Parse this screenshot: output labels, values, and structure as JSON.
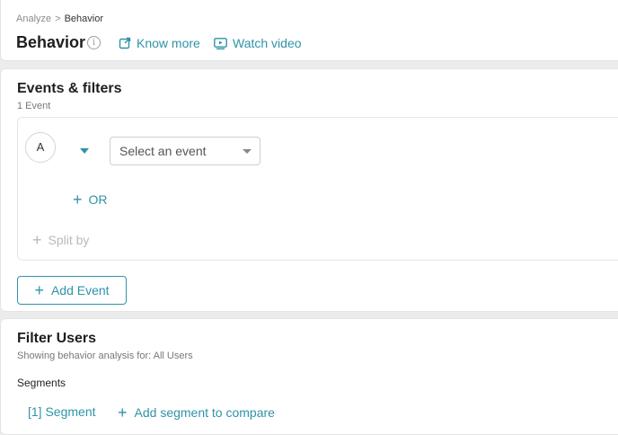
{
  "breadcrumb": {
    "parent": "Analyze",
    "separator": ">",
    "current": "Behavior"
  },
  "header": {
    "title": "Behavior",
    "info_glyph": "i",
    "know_more": "Know more",
    "watch_video": "Watch video"
  },
  "events": {
    "title": "Events & filters",
    "count": "1 Event",
    "badge": "A",
    "select_placeholder": "Select an event",
    "or_label": "OR",
    "split_by": "Split by",
    "add_event": "Add Event"
  },
  "filter_users": {
    "title": "Filter Users",
    "subtitle": "Showing behavior analysis for: All Users",
    "segments_label": "Segments",
    "segment_item": "[1] Segment",
    "add_segment": "Add segment to compare"
  },
  "icons": {
    "plus": "+",
    "external_link": "external-link-icon",
    "video": "video-icon"
  },
  "colors": {
    "accent": "#2f93a8",
    "background": "#ececec"
  }
}
